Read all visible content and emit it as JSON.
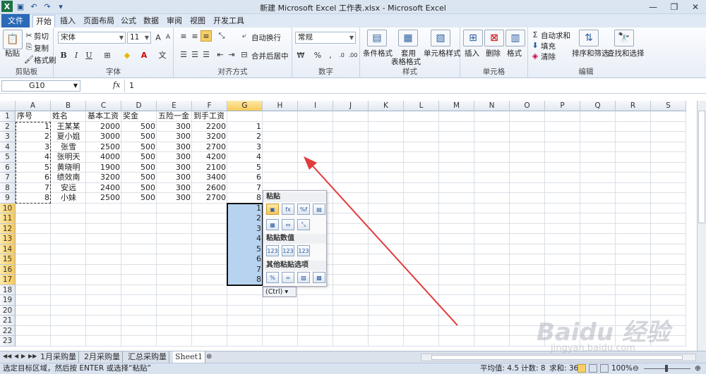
{
  "window": {
    "title": "新建 Microsoft Excel 工作表.xlsx - Microsoft Excel"
  },
  "tabs": [
    "开始",
    "插入",
    "页面布局",
    "公式",
    "数据",
    "审阅",
    "视图",
    "开发工具"
  ],
  "file_tab": "文件",
  "ribbon": {
    "clipboard": {
      "paste": "粘贴",
      "cut": "剪切",
      "copy": "复制",
      "format_painter": "格式刷",
      "label": "剪贴板"
    },
    "font": {
      "name": "宋体",
      "size": "11",
      "bold": "B",
      "italic": "I",
      "underline": "U",
      "label": "字体"
    },
    "alignment": {
      "wrap": "自动换行",
      "merge": "合并后居中",
      "label": "对齐方式"
    },
    "number": {
      "format": "常规",
      "label": "数字"
    },
    "styles": {
      "conditional": "条件格式",
      "table1": "套用",
      "table2": "表格格式",
      "cell_styles": "单元格样式",
      "label": "样式"
    },
    "cells": {
      "insert": "插入",
      "delete": "删除",
      "format": "格式",
      "label": "单元格"
    },
    "editing": {
      "autosum": "自动求和",
      "fill": "填充",
      "clear": "清除",
      "sort": "排序和筛选",
      "find": "查找和选择",
      "label": "编辑"
    }
  },
  "formula_bar": {
    "name_box": "G10",
    "fx": "fx",
    "value": "1"
  },
  "columns": [
    "A",
    "B",
    "C",
    "D",
    "E",
    "F",
    "G",
    "H",
    "I",
    "J",
    "K",
    "L",
    "M",
    "N",
    "O",
    "P",
    "Q",
    "R",
    "S"
  ],
  "rows": [
    "1",
    "2",
    "3",
    "4",
    "5",
    "6",
    "7",
    "8",
    "9",
    "10",
    "11",
    "12",
    "13",
    "14",
    "15",
    "16",
    "17",
    "18",
    "19",
    "20",
    "21",
    "22",
    "23"
  ],
  "table": {
    "headers": [
      "序号",
      "姓名",
      "基本工资",
      "奖金",
      "五险一金",
      "到手工资"
    ],
    "data": [
      [
        "1",
        "王某某",
        "2000",
        "500",
        "300",
        "2200",
        "1"
      ],
      [
        "2",
        "夏小姐",
        "3000",
        "500",
        "300",
        "3200",
        "2"
      ],
      [
        "3",
        "张雪",
        "2500",
        "500",
        "300",
        "2700",
        "3"
      ],
      [
        "4",
        "张明天",
        "4000",
        "500",
        "300",
        "4200",
        "4"
      ],
      [
        "5",
        "黄晓明",
        "1900",
        "500",
        "300",
        "2100",
        "5"
      ],
      [
        "6",
        "绩效南",
        "3200",
        "500",
        "300",
        "3400",
        "6"
      ],
      [
        "7",
        "安远",
        "2400",
        "500",
        "300",
        "2600",
        "7"
      ],
      [
        "8",
        "小妹",
        "2500",
        "500",
        "300",
        "2700",
        "8"
      ]
    ],
    "pasted": [
      "1",
      "2",
      "3",
      "4",
      "5",
      "6",
      "7",
      "8"
    ]
  },
  "paste_menu": {
    "section1": "粘贴",
    "section2": "粘贴数值",
    "section3": "其他粘贴选项",
    "ctrl": "(Ctrl)"
  },
  "sheet_tabs": [
    "1月采购量",
    "2月采购量",
    "汇总采购量",
    "Sheet1"
  ],
  "status": {
    "left": "选定目标区域，然后按 ENTER 或选择“粘贴”",
    "average": "平均值: 4.5",
    "count": "计数: 8",
    "sum": "求和: 36",
    "zoom": "100%"
  },
  "watermark": {
    "brand": "Baidu 经验",
    "url": "jingyan.baidu.com"
  }
}
